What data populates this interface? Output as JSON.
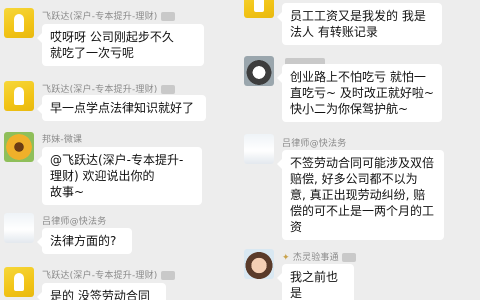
{
  "left_column": [
    {
      "sender": "飞跃达(深户-专本提升-理财)",
      "avatar": "yellow-portrait",
      "text": "哎呀呀    公司刚起步不久\n就吃了一次亏呢"
    },
    {
      "sender": "飞跃达(深户-专本提升-理财)",
      "avatar": "yellow-portrait",
      "text": "早一点学点法律知识就好了"
    },
    {
      "sender": "邦妹-微课",
      "avatar": "flower",
      "text": "@飞跃达(深户-专本提升-\n理财)       欢迎说出你的\n故事~"
    },
    {
      "sender": "吕律师@快法务",
      "avatar": "wedding",
      "text": "法律方面的?"
    },
    {
      "sender": "飞跃达(深户-专本提升-理财)",
      "avatar": "yellow-portrait",
      "text": "是的  没签劳动合同"
    }
  ],
  "right_column": [
    {
      "sender": "",
      "avatar": "yellow-portrait",
      "text": "员工工资又是我发的   我是\n法人  有转账记录"
    },
    {
      "sender": "",
      "avatar": "cat",
      "text": "创业路上不怕吃亏 就怕一\n直吃亏~ 及时改正就好啦~\n快小二为你保驾护航~"
    },
    {
      "sender": "吕律师@快法务",
      "avatar": "wedding",
      "text": "不签劳动合同可能涉及双倍\n赔偿, 好多公司都不以为\n意, 真正出现劳动纠纷, 赔\n偿的可不止是一两个月的工\n资"
    },
    {
      "sender": "杰灵验事通",
      "avatar": "girl",
      "text": "我之前也是"
    }
  ]
}
